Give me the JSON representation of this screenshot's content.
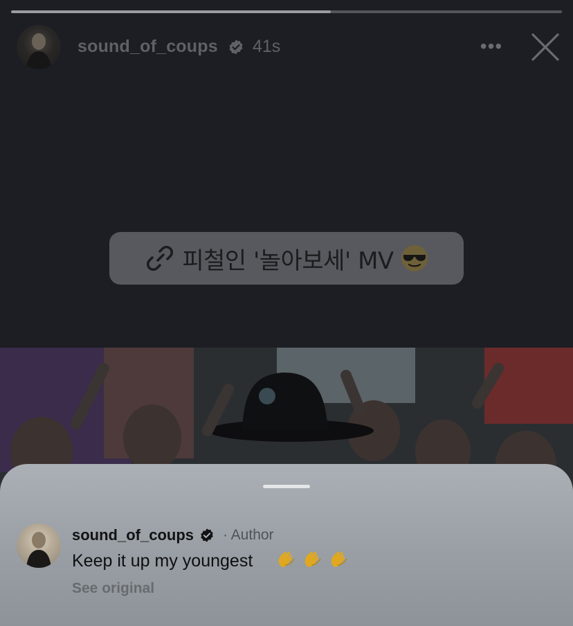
{
  "story": {
    "progress_fraction": 0.58,
    "header": {
      "username": "sound_of_coups",
      "timestamp": "41s",
      "more_label": "•••",
      "icons": [
        "avatar",
        "verified-badge-icon",
        "more-options-icon",
        "close-icon"
      ]
    },
    "link_sticker": {
      "text": "피철인 '놀아보세' MV",
      "icons": [
        "link-icon",
        "sunglasses-emoji-icon"
      ]
    }
  },
  "comment_sheet": {
    "username": "sound_of_coups",
    "author_label": "· Author",
    "text": "Keep it up my youngest",
    "emoji": [
      "clapping-hands-emoji-icon",
      "clapping-hands-emoji-icon",
      "clapping-hands-emoji-icon"
    ],
    "see_original": "See original"
  },
  "colors": {
    "background": "#1c1e23",
    "sheet": "#9aa0a5",
    "sticker": "#57595e",
    "verified": "#6a6c71"
  }
}
